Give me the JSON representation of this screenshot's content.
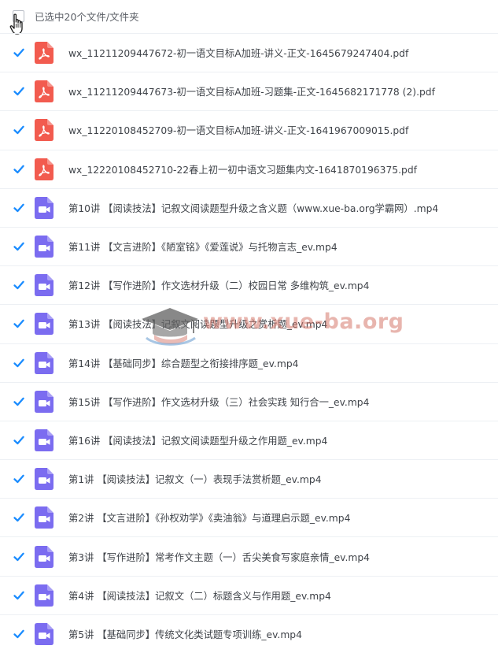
{
  "header": {
    "selection_label": "已选中20个文件/文件夹"
  },
  "colors": {
    "accent_check": "#1a8cff",
    "pdf_icon": "#f25b4f",
    "video_icon": "#7b6cf0"
  },
  "watermark": {
    "text": "www.xue-ba.org"
  },
  "files": [
    {
      "type": "pdf",
      "icon": "pdf-file-icon",
      "name": "wx_11211209447672-初一语文目标A加班-讲义-正文-1645679247404.pdf",
      "checked": true
    },
    {
      "type": "pdf",
      "icon": "pdf-file-icon",
      "name": "wx_11211209447673-初一语文目标A加班-习题集-正文-1645682171778 (2).pdf",
      "checked": true
    },
    {
      "type": "pdf",
      "icon": "pdf-file-icon",
      "name": "wx_11220108452709-初一语文目标A加班-讲义-正文-1641967009015.pdf",
      "checked": true
    },
    {
      "type": "pdf",
      "icon": "pdf-file-icon",
      "name": "wx_12220108452710-22春上初一初中语文习题集内文-1641870196375.pdf",
      "checked": true
    },
    {
      "type": "video",
      "icon": "video-file-icon",
      "name": "第10讲 【阅读技法】记叙文阅读题型升级之含义题（www.xue-ba.org学霸网）.mp4",
      "checked": true
    },
    {
      "type": "video",
      "icon": "video-file-icon",
      "name": "第11讲 【文言进阶】《陋室铭》《爱莲说》与托物言志_ev.mp4",
      "checked": true
    },
    {
      "type": "video",
      "icon": "video-file-icon",
      "name": "第12讲 【写作进阶】作文选材升级（二）校园日常 多维构筑_ev.mp4",
      "checked": true
    },
    {
      "type": "video",
      "icon": "video-file-icon",
      "name": "第13讲 【阅读技法】记叙文阅读题型升级之赏析题_ev.mp4",
      "checked": true
    },
    {
      "type": "video",
      "icon": "video-file-icon",
      "name": "第14讲 【基础同步】综合题型之衔接排序题_ev.mp4",
      "checked": true
    },
    {
      "type": "video",
      "icon": "video-file-icon",
      "name": "第15讲 【写作进阶】作文选材升级（三）社会实践 知行合一_ev.mp4",
      "checked": true
    },
    {
      "type": "video",
      "icon": "video-file-icon",
      "name": "第16讲 【阅读技法】记叙文阅读题型升级之作用题_ev.mp4",
      "checked": true
    },
    {
      "type": "video",
      "icon": "video-file-icon",
      "name": "第1讲 【阅读技法】记叙文（一）表现手法赏析题_ev.mp4",
      "checked": true
    },
    {
      "type": "video",
      "icon": "video-file-icon",
      "name": "第2讲 【文言进阶】《孙权劝学》《卖油翁》与道理启示题_ev.mp4",
      "checked": true
    },
    {
      "type": "video",
      "icon": "video-file-icon",
      "name": "第3讲 【写作进阶】常考作文主题（一）舌尖美食写家庭亲情_ev.mp4",
      "checked": true
    },
    {
      "type": "video",
      "icon": "video-file-icon",
      "name": "第4讲 【阅读技法】记叙文（二）标题含义与作用题_ev.mp4",
      "checked": true
    },
    {
      "type": "video",
      "icon": "video-file-icon",
      "name": "第5讲 【基础同步】传统文化类试题专项训练_ev.mp4",
      "checked": true
    }
  ]
}
